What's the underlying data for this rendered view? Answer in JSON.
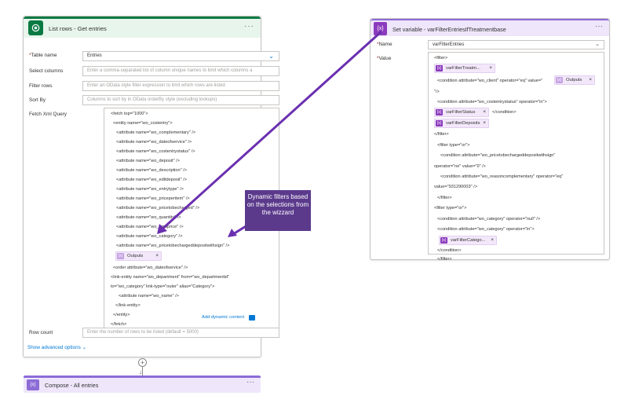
{
  "left_card": {
    "title": "List rows - Get entries",
    "menu_dots": "···",
    "table_name": {
      "label": "Table name",
      "required": "*",
      "value": "Entries"
    },
    "select_columns": {
      "label": "Select columns",
      "placeholder": "Enter a comma-separated list of column unique names to limit which columns a"
    },
    "filter_rows": {
      "label": "Filter rows",
      "placeholder": "Enter an OData style filter expression to limit which rows are listed"
    },
    "sort_by": {
      "label": "Sort By",
      "placeholder": "Columns to sort by in OData orderBy style (excluding lookups)"
    },
    "fetch_xml": {
      "label": "Fetch Xml Query",
      "lines": [
        "<fetch top=\"1000\">",
        "<entity name=\"wo_costentry\">",
        "<attribute name=\"wo_complementary\" />",
        "<attribute name=\"wo_dateofservice\" />",
        "<attribute name=\"wo_costentrystatus\" />",
        "<attribute name=\"wo_deposit\" />",
        "<attribute name=\"wo_description\" />",
        "<attribute name=\"wo_editdeposit\" />",
        "<attribute name=\"wo_entrytype\" />",
        "<attribute name=\"wo_priceperitem\" />",
        "<attribute name=\"wo_pricetobecharged\" />",
        "<attribute name=\"wo_quantity\" />",
        "<attribute name=\"wo_totalprice\" />",
        "<attribute name=\"wo_category\" />",
        "<attribute name=\"wo_pricetobechargeddepositwithsign\" />",
        "<order attribute=\"wo_dateofservice\" />",
        "<link-entity name=\"wo_department\" from=\"wo_departmentid\"",
        "to=\"wo_category\" link-type=\"outer\" alias=\"Category\">",
        "<attribute name=\"wo_name\" />",
        "</link-entity>",
        "</entity>",
        "</fetch>"
      ],
      "token_outputs": "Outputs"
    },
    "add_dynamic_content": "Add dynamic content",
    "row_count": {
      "label": "Row count",
      "placeholder": "Enter the number of rows to be listed (default = 5000)"
    },
    "show_advanced": "Show advanced options"
  },
  "compose_card": {
    "title": "Compose - All entries",
    "icon_text": "{x}",
    "menu_dots": "···"
  },
  "right_card": {
    "title": "Set variable - varFilterEntriesIfTreatmentbase",
    "icon_text": "{x}",
    "menu_dots": "···",
    "name": {
      "label": "Name",
      "required": "*",
      "value": "varFilterEntries"
    },
    "value": {
      "label": "Value",
      "required": "*",
      "lines": {
        "l1": "<filter>",
        "l2a": "<condition attribute=\"wo_client\" operator=\"eq\" value=\"",
        "l3": "\"/>",
        "l4": "<condition attribute=\"wo_costentrystatus\" operator=\"in\">",
        "l5b": "</condition>",
        "l7": "</filter>",
        "l8": "<filter type=\"or\">",
        "l9": "<condition attribute=\"wo_pricetobechargeddepositwithsign\"",
        "l10": "operator=\"ne\" value=\"0\" />",
        "l11": "<condition attribute=\"wo_reasoncomplementary\" operator=\"eq\"",
        "l12": "value=\"931290003\" />",
        "l13": "</filter>",
        "l14": "<filter type=\"or\">",
        "l15": "<condition attribute=\"wo_category\" operator=\"null\" />",
        "l16": "<condition attribute=\"wo_category\" operator=\"in\">",
        "l18": "</condition>",
        "l19": "</filter>"
      },
      "tokens": {
        "treatm": "varFilterTreatm...",
        "outputs": "Outputs",
        "status": "varFilterStatus",
        "deposits": "varFilterDeposits",
        "catego": "varFilterCatego..."
      }
    }
  },
  "annotation": {
    "text": "Dynamic filters based on the selections from the wizzard",
    "color": "#5b3a8c"
  },
  "colors": {
    "dataverse_green": "#0b7a43",
    "variable_purple": "#8b3bbd",
    "link_blue": "#0078d4"
  }
}
